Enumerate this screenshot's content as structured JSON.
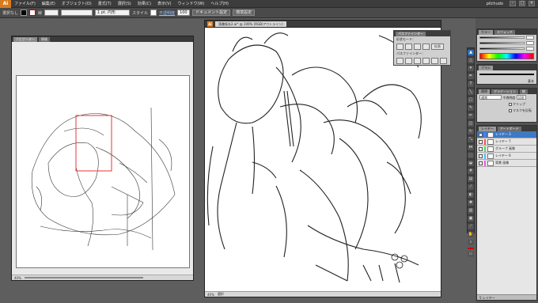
{
  "app": {
    "logo": "Ai",
    "user": "pilchudo"
  },
  "menubar": {
    "items": [
      "ファイル(F)",
      "編集(E)",
      "オブジェクト(O)",
      "書式(T)",
      "選択(S)",
      "効果(C)",
      "表示(V)",
      "ウィンドウ(W)",
      "ヘルプ(H)"
    ]
  },
  "controlbar": {
    "selection_label": "選択なし",
    "stroke_label": "線",
    "brush_value": "1 pt. 円形",
    "style_label": "スタイル",
    "opacity_label": "不透明度",
    "opacity_value": "100",
    "doc_setup_button": "ドキュメント設定",
    "prefs_button": "環境設定"
  },
  "tools": {
    "icons": [
      "selection-tool-icon",
      "direct-select-tool-icon",
      "magic-wand-tool-icon",
      "lasso-tool-icon",
      "pen-tool-icon",
      "type-tool-icon",
      "line-tool-icon",
      "rectangle-tool-icon",
      "paintbrush-tool-icon",
      "pencil-tool-icon",
      "blob-brush-tool-icon",
      "eraser-tool-icon",
      "rotate-tool-icon",
      "scale-tool-icon",
      "width-tool-icon",
      "free-transform-tool-icon",
      "shape-builder-tool-icon",
      "perspective-tool-icon",
      "mesh-tool-icon",
      "gradient-tool-icon",
      "eyedropper-tool-icon",
      "blend-tool-icon",
      "symbol-sprayer-tool-icon",
      "graph-tool-icon",
      "artboard-tool-icon",
      "slice-tool-icon",
      "hand-tool-icon",
      "zoom-tool-icon",
      "fill-stroke-icon",
      "screen-mode-icon"
    ]
  },
  "navigator": {
    "tabs": [
      "ナビゲーター",
      "情報"
    ],
    "zoom": "40%"
  },
  "document": {
    "tab_title": "落書既存2.ai* @ 100% (RGB/アウトライン)",
    "zoom": "40%",
    "status": "選択"
  },
  "pathfinder": {
    "tab": "パスファインダー",
    "shape_mode_label": "形状モード：",
    "pathfinder_label": "パスファインダー：",
    "expand_button": "拡張"
  },
  "panels": {
    "color_tabs": [
      "カラー",
      "スウォッチ"
    ],
    "brush_tab": "ブラシ",
    "brush_basic": "基本",
    "transparency_tabs": [
      "透明",
      "グラデーション",
      "線"
    ],
    "blend_mode": "通常",
    "opacity_label": "不透明度",
    "opacity_value": "100",
    "clip_label": "クリップ",
    "invert_mask_label": "マスクを反転",
    "layers_tabs": [
      "レイヤー",
      "アートボード"
    ],
    "layers": [
      {
        "name": "レイヤー 3",
        "color": "#4f7fff",
        "selected": true
      },
      {
        "name": "レイヤー 7",
        "color": "#ff4f4f",
        "selected": false
      },
      {
        "name": "グループ 画像",
        "color": "#4fdf4f",
        "selected": false
      },
      {
        "name": "レイヤー 6",
        "color": "#4fc0ff",
        "selected": false
      },
      {
        "name": "背景 画像",
        "color": "#ff4fff",
        "selected": false
      }
    ],
    "layers_count": "5 レイヤー"
  }
}
